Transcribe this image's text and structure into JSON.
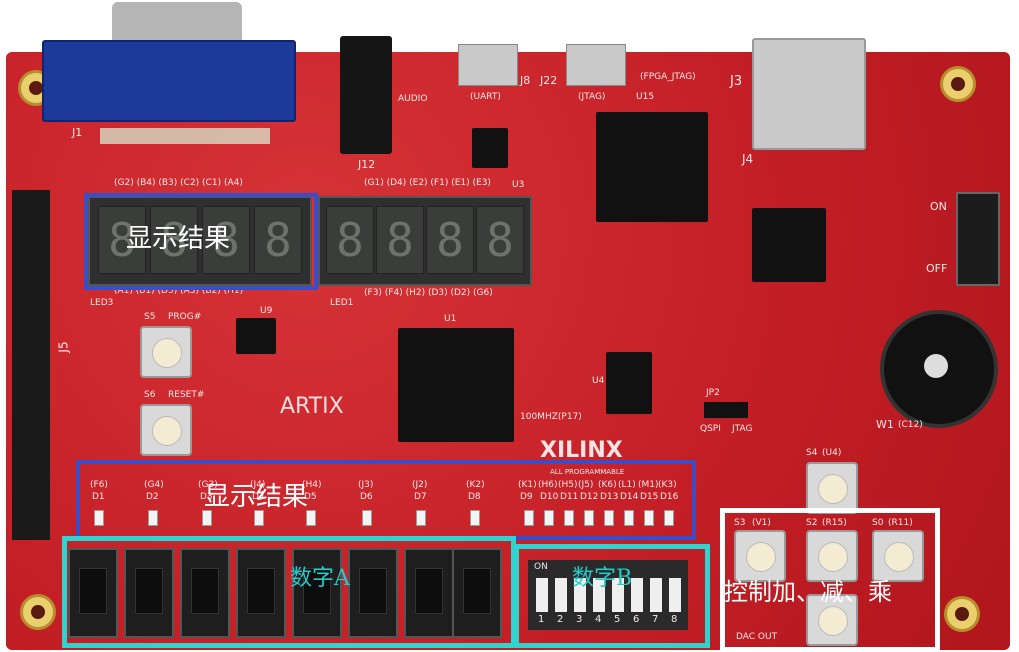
{
  "annotations": {
    "seg_label": "显示结果",
    "led_label": "显示结果",
    "switch_label": "数字A",
    "dip_label": "数字B",
    "buttons_label": "控制加、减、乘"
  },
  "silkscreen": {
    "j1": "J1",
    "j12": "J12",
    "j8": "J8",
    "j22": "J22",
    "j3": "J3",
    "j4": "J4",
    "j5": "J5",
    "u1": "U1",
    "u3": "U3",
    "u15": "U15",
    "audio": "AUDIO",
    "uart": "(UART)",
    "jtag_usb": "(JTAG)",
    "fpga_jtag": "(FPGA_JTAG)",
    "artix": "ARTIX",
    "xilinx": "XILINX",
    "all_programmable": "ALL PROGRAMMABLE",
    "clock": "100MHZ(P17)",
    "qspi": "QSPI",
    "jtag": "JTAG",
    "prog": "PROG#",
    "reset": "RESET#",
    "s5": "S5",
    "s6": "S6",
    "u9": "U9",
    "u4": "U4",
    "jp2": "JP2",
    "w1": "W1",
    "w1_pin": "(C12)",
    "on": "ON",
    "off": "OFF",
    "dac_out": "DAC OUT",
    "led3": "LED3",
    "led1": "LED1",
    "s4": "S4",
    "s4_pin": "(U4)",
    "s3": "S3",
    "s3_pin": "(V1)",
    "s2": "S2",
    "s2_pin": "(R15)",
    "s0": "S0",
    "s0_pin": "(R11)",
    "seg_pins_top_left": "(G2) (B4) (B3) (C2) (C1) (A4)",
    "seg_pins_top_right": "(G1) (D4) (E2) (F1) (E1) (E3)",
    "seg_pins_bot_left": "(A1) (B1) (D5) (A3) (B2) (H1)",
    "seg_pins_bot_right": "(F3) (F4) (H2) (D3) (D2) (G6)"
  },
  "digits": [
    "8",
    "8",
    "8",
    "8",
    "8",
    "8",
    "8",
    "8"
  ],
  "leds_left": [
    "D1",
    "D2",
    "D3",
    "D4",
    "D5",
    "D6",
    "D7",
    "D8"
  ],
  "leds_left_pins": [
    "(F6)",
    "(G4)",
    "(G3)",
    "(J4)",
    "(H4)",
    "(J3)",
    "(J2)",
    "(K2)"
  ],
  "leds_right": [
    "D9",
    "D10",
    "D11",
    "D12",
    "D13",
    "D14",
    "D15",
    "D16"
  ],
  "leds_right_pins": [
    "(K1)",
    "(H6)",
    "(H5)",
    "(J5)",
    "(K6)",
    "(L1)",
    "(M1)",
    "(K3)"
  ],
  "dip_numbers": [
    "1",
    "2",
    "3",
    "4",
    "5",
    "6",
    "7",
    "8"
  ],
  "dip_on": "ON",
  "colors": {
    "board": "#c8242a",
    "blue_box": "#3a4fc7",
    "cyan_box": "#2fd3d0",
    "white_box": "#ffffff",
    "label_white": "#ffffff",
    "label_cyan": "#27c9c6"
  }
}
